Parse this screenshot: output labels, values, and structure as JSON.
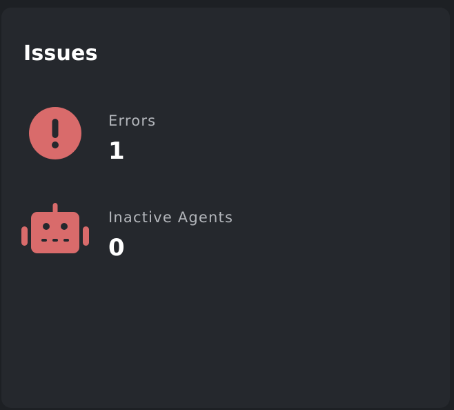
{
  "card": {
    "title": "Issues"
  },
  "issues": [
    {
      "label": "Errors",
      "value": "1",
      "icon": "exclamation-circle-icon"
    },
    {
      "label": "Inactive Agents",
      "value": "0",
      "icon": "robot-icon"
    }
  ],
  "colors": {
    "background": "#1d2024",
    "card": "#25282d",
    "accent": "#d96b6b",
    "label": "#b3b6bb",
    "value": "#ffffff"
  }
}
